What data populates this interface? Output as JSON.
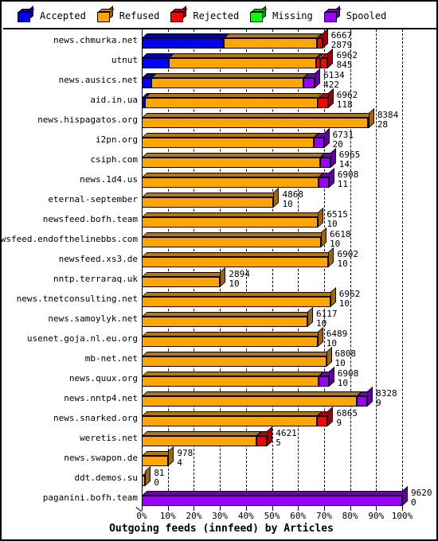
{
  "legend": {
    "items": [
      {
        "label": "Accepted",
        "color": "#0000ff",
        "key": "accepted"
      },
      {
        "label": "Refused",
        "color": "#ffa500",
        "key": "refused"
      },
      {
        "label": "Rejected",
        "color": "#ff0000",
        "key": "rejected"
      },
      {
        "label": "Missing",
        "color": "#00ff00",
        "key": "missing"
      },
      {
        "label": "Spooled",
        "color": "#9900ff",
        "key": "spooled"
      }
    ]
  },
  "axis": {
    "title": "Outgoing feeds (innfeed) by Articles",
    "ticks": [
      "0%",
      "10%",
      "20%",
      "30%",
      "40%",
      "50%",
      "60%",
      "70%",
      "80%",
      "90%",
      "100%"
    ]
  },
  "chart_data": {
    "type": "bar",
    "orientation": "horizontal",
    "stacked": true,
    "title": "Outgoing feeds (innfeed) by Articles",
    "xlabel": "Outgoing feeds (innfeed) by Articles",
    "ylabel": "",
    "xlim": [
      0,
      100
    ],
    "xunit": "percent",
    "grid": true,
    "legend_position": "top",
    "series_names": [
      "Accepted",
      "Refused",
      "Rejected",
      "Missing",
      "Spooled"
    ],
    "series_colors": [
      "#0000ff",
      "#ffa500",
      "#ff0000",
      "#00ff00",
      "#9900ff"
    ],
    "scale_max_articles": 9620,
    "categories": [
      "news.chmurka.net",
      "utnut",
      "news.ausics.net",
      "aid.in.ua",
      "news.hispagatos.org",
      "i2pn.org",
      "csiph.com",
      "news.1d4.us",
      "eternal-september",
      "newsfeed.bofh.team",
      "newsfeed.endofthelinebbs.com",
      "newsfeed.xs3.de",
      "nntp.terraraq.uk",
      "news.tnetconsulting.net",
      "news.samoylyk.net",
      "usenet.goja.nl.eu.org",
      "mb-net.net",
      "news.quux.org",
      "news.nntp4.net",
      "news.snarked.org",
      "weretis.net",
      "news.swapon.de",
      "ddt.demos.su",
      "paganini.bofh.team"
    ],
    "rows": [
      {
        "label": "news.chmurka.net",
        "total": 6667,
        "secondary": 2879,
        "segments": [
          {
            "key": "accepted",
            "pct": 31.5
          },
          {
            "key": "refused",
            "pct": 35.8
          },
          {
            "key": "rejected",
            "pct": 2.0
          }
        ]
      },
      {
        "label": "utnut",
        "total": 6962,
        "secondary": 845,
        "segments": [
          {
            "key": "accepted",
            "pct": 10.5
          },
          {
            "key": "refused",
            "pct": 56.6
          },
          {
            "key": "rejected",
            "pct": 1.3
          },
          {
            "key": "rejected",
            "pct": 3.0
          }
        ]
      },
      {
        "label": "news.ausics.net",
        "total": 6134,
        "secondary": 422,
        "segments": [
          {
            "key": "accepted",
            "pct": 3.6
          },
          {
            "key": "refused",
            "pct": 58.5
          },
          {
            "key": "spooled",
            "pct": 4.3
          }
        ]
      },
      {
        "label": "aid.in.ua",
        "total": 6962,
        "secondary": 118,
        "segments": [
          {
            "key": "accepted",
            "pct": 1.3
          },
          {
            "key": "refused",
            "pct": 66.2
          },
          {
            "key": "rejected",
            "pct": 4.0
          }
        ]
      },
      {
        "label": "news.hispagatos.org",
        "total": 8384,
        "secondary": 28,
        "segments": [
          {
            "key": "refused",
            "pct": 86.8
          },
          {
            "key": "refused",
            "pct": 0.3
          }
        ]
      },
      {
        "label": "i2pn.org",
        "total": 6731,
        "secondary": 20,
        "segments": [
          {
            "key": "refused",
            "pct": 66.0
          },
          {
            "key": "spooled",
            "pct": 3.9
          }
        ]
      },
      {
        "label": "csiph.com",
        "total": 6965,
        "secondary": 14,
        "segments": [
          {
            "key": "refused",
            "pct": 68.5
          },
          {
            "key": "spooled",
            "pct": 3.9
          }
        ]
      },
      {
        "label": "news.1d4.us",
        "total": 6908,
        "secondary": 11,
        "segments": [
          {
            "key": "refused",
            "pct": 67.9
          },
          {
            "key": "spooled",
            "pct": 3.9
          }
        ]
      },
      {
        "label": "eternal-september",
        "total": 4868,
        "secondary": 10,
        "segments": [
          {
            "key": "refused",
            "pct": 50.6
          }
        ]
      },
      {
        "label": "newsfeed.bofh.team",
        "total": 6515,
        "secondary": 10,
        "segments": [
          {
            "key": "refused",
            "pct": 67.7
          }
        ]
      },
      {
        "label": "newsfeed.endofthelinebbs.com",
        "total": 6618,
        "secondary": 10,
        "segments": [
          {
            "key": "refused",
            "pct": 68.8
          }
        ]
      },
      {
        "label": "newsfeed.xs3.de",
        "total": 6902,
        "secondary": 10,
        "segments": [
          {
            "key": "refused",
            "pct": 71.7
          }
        ]
      },
      {
        "label": "nntp.terraraq.uk",
        "total": 2894,
        "secondary": 10,
        "segments": [
          {
            "key": "refused",
            "pct": 30.1
          }
        ]
      },
      {
        "label": "news.tnetconsulting.net",
        "total": 6962,
        "secondary": 10,
        "segments": [
          {
            "key": "refused",
            "pct": 72.4
          }
        ]
      },
      {
        "label": "news.samoylyk.net",
        "total": 6117,
        "secondary": 10,
        "segments": [
          {
            "key": "refused",
            "pct": 63.6
          }
        ]
      },
      {
        "label": "usenet.goja.nl.eu.org",
        "total": 6489,
        "secondary": 10,
        "segments": [
          {
            "key": "refused",
            "pct": 67.5
          }
        ]
      },
      {
        "label": "mb-net.net",
        "total": 6808,
        "secondary": 10,
        "segments": [
          {
            "key": "refused",
            "pct": 70.8
          }
        ]
      },
      {
        "label": "news.quux.org",
        "total": 6908,
        "secondary": 10,
        "segments": [
          {
            "key": "refused",
            "pct": 67.9
          },
          {
            "key": "spooled",
            "pct": 3.9
          }
        ]
      },
      {
        "label": "news.nntp4.net",
        "total": 8328,
        "secondary": 9,
        "segments": [
          {
            "key": "refused",
            "pct": 82.7
          },
          {
            "key": "spooled",
            "pct": 3.9
          }
        ]
      },
      {
        "label": "news.snarked.org",
        "total": 6865,
        "secondary": 9,
        "segments": [
          {
            "key": "refused",
            "pct": 67.4
          },
          {
            "key": "rejected",
            "pct": 4.0
          }
        ]
      },
      {
        "label": "weretis.net",
        "total": 4621,
        "secondary": 5,
        "segments": [
          {
            "key": "refused",
            "pct": 44.1
          },
          {
            "key": "rejected",
            "pct": 4.0
          }
        ]
      },
      {
        "label": "news.swapon.de",
        "total": 978,
        "secondary": 4,
        "segments": [
          {
            "key": "refused",
            "pct": 10.2
          }
        ]
      },
      {
        "label": "ddt.demos.su",
        "total": 81,
        "secondary": 0,
        "segments": [
          {
            "key": "refused",
            "pct": 1.3
          }
        ]
      },
      {
        "label": "paganini.bofh.team",
        "total": 9620,
        "secondary": 0,
        "segments": [
          {
            "key": "spooled",
            "pct": 100.0
          }
        ]
      }
    ]
  }
}
